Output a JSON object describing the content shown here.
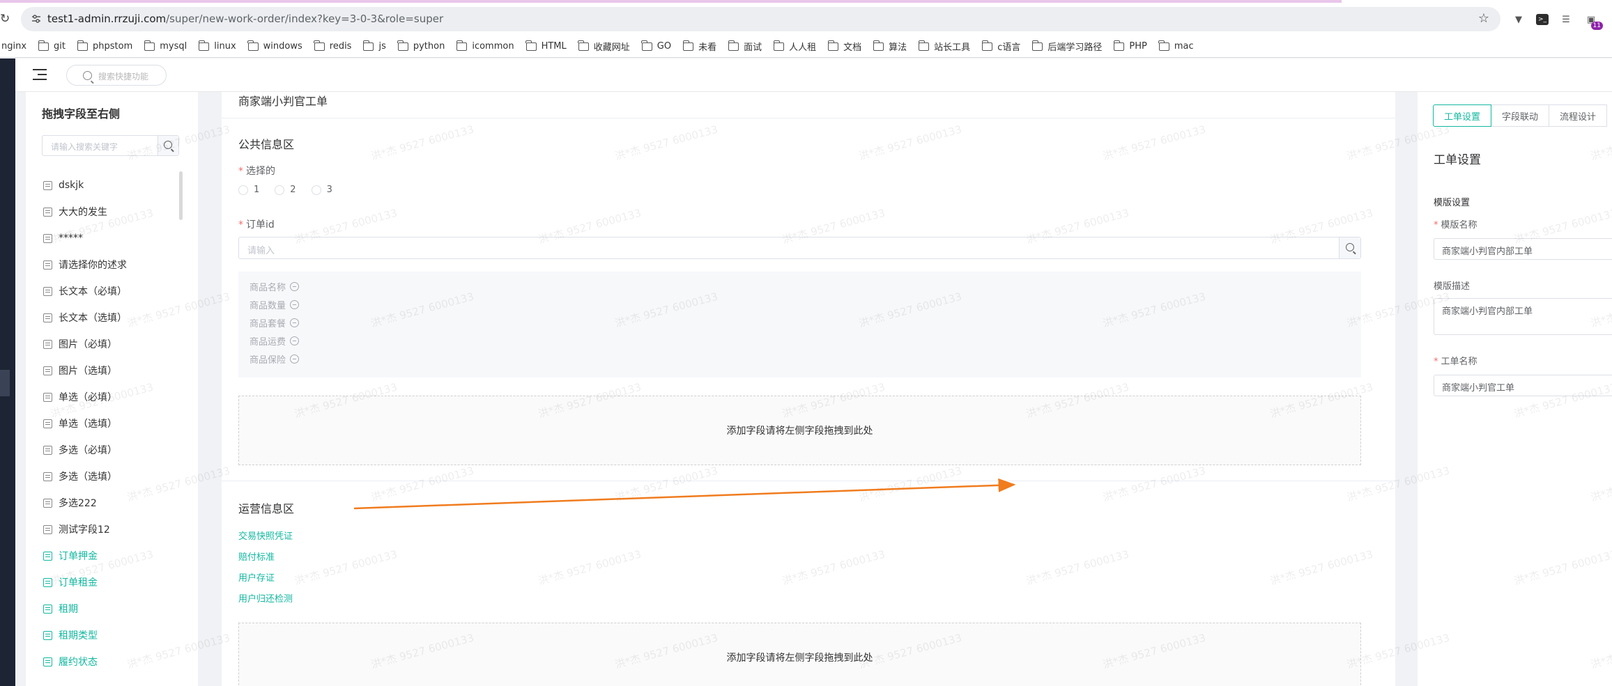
{
  "browser": {
    "url_host": "test1-admin.rrzuji.com",
    "url_path": "/super/new-work-order/index?key=3-0-3&role=super",
    "extension_badge": "11",
    "bookmarks": [
      "nginx",
      "git",
      "phpstom",
      "mysql",
      "linux",
      "windows",
      "redis",
      "js",
      "python",
      "icommon",
      "HTML",
      "收藏网址",
      "GO",
      "未看",
      "面试",
      "人人租",
      "文档",
      "算法",
      "站长工具",
      "c语言",
      "后端学习路径",
      "PHP",
      "mac"
    ]
  },
  "header": {
    "search_placeholder": "搜索快捷功能"
  },
  "palette": {
    "title": "拖拽字段至右侧",
    "search_placeholder": "请输入搜索关键字",
    "fields": [
      {
        "label": "dskjk",
        "teal": false
      },
      {
        "label": "大大的发生",
        "teal": false
      },
      {
        "label": "*****",
        "teal": false
      },
      {
        "label": "请选择你的述求",
        "teal": false
      },
      {
        "label": "长文本（必填）",
        "teal": false
      },
      {
        "label": "长文本（选填）",
        "teal": false
      },
      {
        "label": "图片（必填）",
        "teal": false
      },
      {
        "label": "图片（选填）",
        "teal": false
      },
      {
        "label": "单选（必填）",
        "teal": false
      },
      {
        "label": "单选（选填）",
        "teal": false
      },
      {
        "label": "多选（必填）",
        "teal": false
      },
      {
        "label": "多选（选填）",
        "teal": false
      },
      {
        "label": "多选222",
        "teal": false
      },
      {
        "label": "测试字段12",
        "teal": false
      },
      {
        "label": "订单押金",
        "teal": true
      },
      {
        "label": "订单租金",
        "teal": true
      },
      {
        "label": "租期",
        "teal": true
      },
      {
        "label": "租期类型",
        "teal": true
      },
      {
        "label": "履约状态",
        "teal": true
      }
    ]
  },
  "form": {
    "title": "商家端小判官工单",
    "public_section": "公共信息区",
    "radio_label": "选择的",
    "radio_options": [
      "1",
      "2",
      "3"
    ],
    "order_label": "订单id",
    "order_placeholder": "请输入",
    "goods": [
      "商品名称",
      "商品数量",
      "商品套餐",
      "商品运费",
      "商品保险"
    ],
    "dropzone_text": "添加字段请将左侧字段拖拽到此处",
    "ops_section": "运营信息区",
    "ops_links": [
      "交易快照凭证",
      "赔付标准",
      "用户存证",
      "用户归还检测"
    ],
    "dropzone_text2": "添加字段请将左侧字段拖拽到此处"
  },
  "settings": {
    "tabs": [
      "工单设置",
      "字段联动",
      "流程设计"
    ],
    "title": "工单设置",
    "template_section": "模版设置",
    "template_name_label": "模版名称",
    "template_name_value": "商家端小判官内部工单",
    "template_desc_label": "模版描述",
    "template_desc_value": "商家端小判官内部工单",
    "order_name_label": "工单名称",
    "order_name_value": "商家端小判官工单"
  },
  "watermark_text": "洪*杰 9527 6000133",
  "colors": {
    "accent": "#13b8a0",
    "arrow": "#f07c1e",
    "required": "#f56c6c"
  }
}
